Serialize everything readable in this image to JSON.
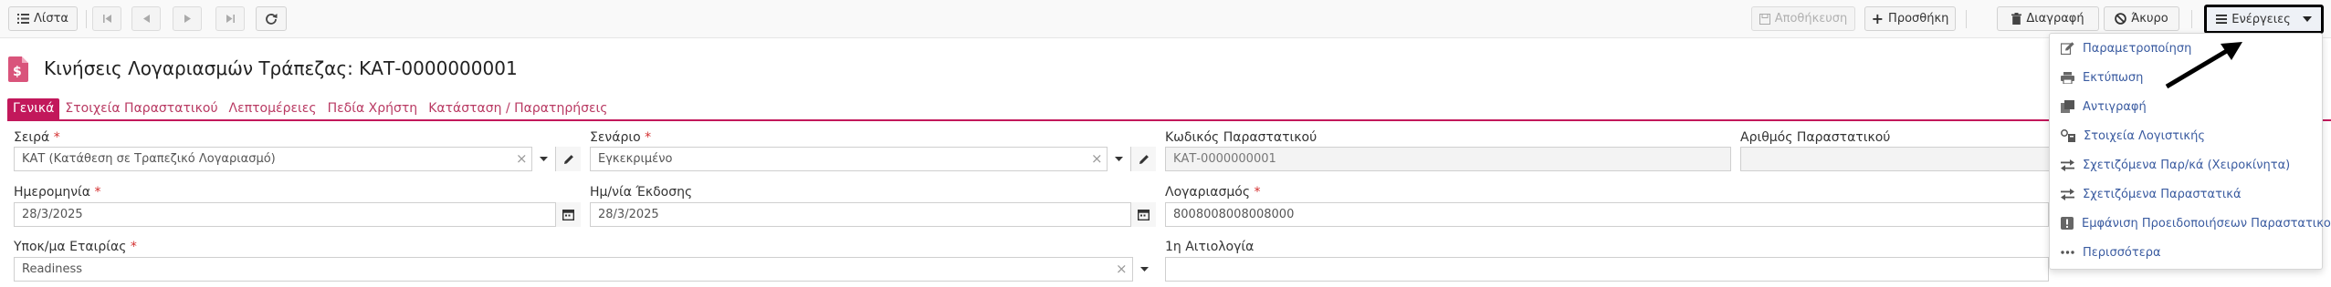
{
  "toolbar": {
    "list_label": "Λίστα",
    "save_label": "Αποθήκευση",
    "add_label": "Προσθήκη",
    "delete_label": "Διαγραφή",
    "cancel_label": "Άκυρο",
    "actions_label": "Ενέργειες"
  },
  "page": {
    "title": "Κινήσεις Λογαριασμών Τράπεζας: ΚΑΤ-0000000001"
  },
  "tabs": [
    {
      "label": "Γενικά",
      "active": true
    },
    {
      "label": "Στοιχεία Παραστατικού"
    },
    {
      "label": "Λεπτομέρειες"
    },
    {
      "label": "Πεδία Χρήστη"
    },
    {
      "label": "Κατάσταση / Παρατηρήσεις"
    }
  ],
  "form": {
    "series": {
      "label": "Σειρά",
      "required": "*",
      "value": "ΚΑΤ (Κατάθεση σε Τραπεζικό Λογαριασμό)"
    },
    "scenario": {
      "label": "Σενάριο",
      "required": "*",
      "value": "Εγκεκριμένο"
    },
    "doc_code": {
      "label": "Κωδικός Παραστατικού",
      "value": "ΚΑΤ-0000000001"
    },
    "doc_number": {
      "label": "Αριθμός Παραστατικού",
      "value": ""
    },
    "date": {
      "label": "Ημερομηνία",
      "required": "*",
      "value": "28/3/2025"
    },
    "issue_date": {
      "label": "Ημ/νία Έκδοσης",
      "value": "28/3/2025"
    },
    "account": {
      "label": "Λογαριασμός",
      "required": "*",
      "value": "8008008008008000"
    },
    "branch": {
      "label": "Υποκ/μα Εταιρίας",
      "required": "*",
      "value": "Readiness"
    },
    "reason": {
      "label": "1η Αιτιολογία",
      "value": ""
    }
  },
  "actions_menu": {
    "items": [
      {
        "label": "Παραμετροποίηση",
        "icon": "edit-icon"
      },
      {
        "label": "Εκτύπωση",
        "icon": "printer-icon"
      },
      {
        "label": "Αντιγραφή",
        "icon": "copy-icon"
      },
      {
        "label": "Στοιχεία Λογιστικής",
        "icon": "balance-icon"
      },
      {
        "label": "Σχετιζόμενα Παρ/κά (Χειροκίνητα)",
        "icon": "exchange-icon"
      },
      {
        "label": "Σχετιζόμενα Παραστατικά",
        "icon": "exchange-icon"
      },
      {
        "label": "Εμφάνιση Προειδοποιήσεων Παραστατικού",
        "icon": "warning-icon"
      },
      {
        "label": "Περισσότερα",
        "icon": "ellipsis-icon"
      }
    ]
  },
  "colors": {
    "accent": "#c2185b",
    "link": "#3a5ba0",
    "required": "#d32f2f"
  }
}
